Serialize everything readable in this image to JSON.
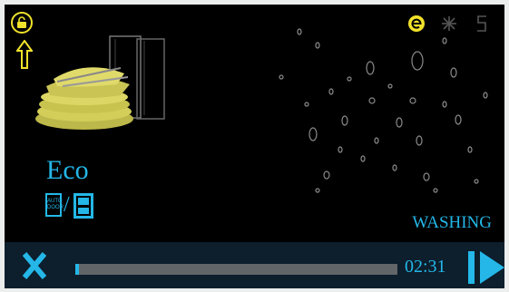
{
  "program": {
    "name": "Eco",
    "auto_door_label_1": "AUTO",
    "auto_door_label_2": "DOOR"
  },
  "status": {
    "text": "WASHING"
  },
  "progress": {
    "time_remaining": "02:31",
    "fraction": 0.01
  },
  "controls": {
    "cancel_label": "X"
  },
  "colors": {
    "accent": "#24b7e8",
    "highlight": "#f1e22b",
    "background": "#000000",
    "bar": "#0d1e2c",
    "track": "#626567"
  },
  "icons": [
    "lock-open-icon",
    "up-arrow-icon",
    "eco-e-icon",
    "sparkle-icon",
    "half-load-icon",
    "auto-door-icon",
    "mode-icon",
    "play-icon"
  ]
}
